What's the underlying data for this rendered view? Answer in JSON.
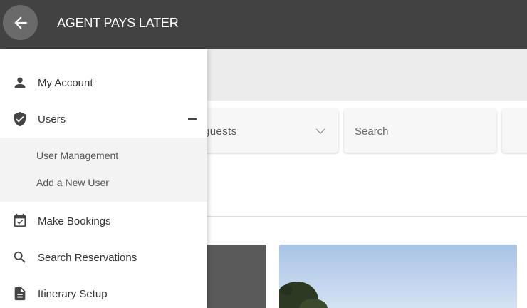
{
  "header": {
    "title": "AGENT PAYS LATER",
    "back_icon": "arrow-left-icon",
    "background_color": "#424242"
  },
  "background_page": {
    "guests_field": {
      "value": "guests",
      "icon": "chevron-down-icon"
    },
    "search_field": {
      "placeholder": "Search"
    }
  },
  "drawer": {
    "items": [
      {
        "label": "My Account",
        "icon": "person-icon"
      },
      {
        "label": "Users",
        "icon": "shield-check-icon",
        "expanded": true,
        "toggle_icon": "minus-icon",
        "children": [
          {
            "label": "User Management"
          },
          {
            "label": "Add a New User"
          }
        ]
      },
      {
        "label": "Make Bookings",
        "icon": "calendar-check-icon"
      },
      {
        "label": "Search Reservations",
        "icon": "search-icon"
      },
      {
        "label": "Itinerary Setup",
        "icon": "document-icon"
      }
    ]
  }
}
